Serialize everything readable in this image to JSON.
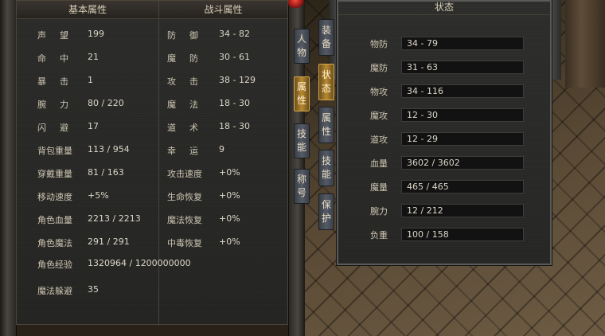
{
  "basic": {
    "header": "基本属性",
    "rows": [
      {
        "label": "声望",
        "value": "199"
      },
      {
        "label": "命中",
        "value": "21"
      },
      {
        "label": "暴击",
        "value": "1"
      },
      {
        "label": "腕力",
        "value": "80 / 220"
      },
      {
        "label": "闪避",
        "value": "17"
      },
      {
        "label": "背包重量",
        "value": "113 / 954"
      },
      {
        "label": "穿戴重量",
        "value": "81 / 163"
      },
      {
        "label": "移动速度",
        "value": "+5%"
      },
      {
        "label": "角色血量",
        "value": "2213 / 2213"
      },
      {
        "label": "角色魔法",
        "value": "291 / 291"
      },
      {
        "label": "角色经验",
        "value": "1320964 / 1200000000"
      },
      {
        "label": "魔法躲避",
        "value": "35"
      }
    ]
  },
  "combat": {
    "header": "战斗属性",
    "rows": [
      {
        "label": "防御",
        "value": "34 - 82"
      },
      {
        "label": "魔防",
        "value": "30 - 61"
      },
      {
        "label": "攻击",
        "value": "38 - 129"
      },
      {
        "label": "魔法",
        "value": "18 - 30"
      },
      {
        "label": "道术",
        "value": "18 - 30"
      },
      {
        "label": "幸运",
        "value": "9"
      },
      {
        "label": "攻击速度",
        "value": "+0%"
      },
      {
        "label": "生命恢复",
        "value": "+0%"
      },
      {
        "label": "魔法恢复",
        "value": "+0%"
      },
      {
        "label": "中毒恢复",
        "value": "+0%"
      }
    ]
  },
  "char_tabs": [
    "人物",
    "属性",
    "技能",
    "称号"
  ],
  "status_tabs": [
    "装备",
    "状态",
    "属性",
    "技能",
    "保护"
  ],
  "status": {
    "title": "状态",
    "rows": [
      {
        "label": "物防",
        "value": "34 - 79"
      },
      {
        "label": "魔防",
        "value": "31 - 63"
      },
      {
        "label": "物攻",
        "value": "34 - 116"
      },
      {
        "label": "魔攻",
        "value": "12 - 30"
      },
      {
        "label": "道攻",
        "value": "12 - 29"
      },
      {
        "label": "血量",
        "value": "3602 / 3602"
      },
      {
        "label": "魔量",
        "value": "465 / 465"
      },
      {
        "label": "腕力",
        "value": "12 / 212"
      },
      {
        "label": "负重",
        "value": "100 / 158"
      }
    ]
  },
  "colors": {
    "active_tab": "#b8892f",
    "inactive_tab": "#555b66",
    "panel": "#2b2b29"
  }
}
